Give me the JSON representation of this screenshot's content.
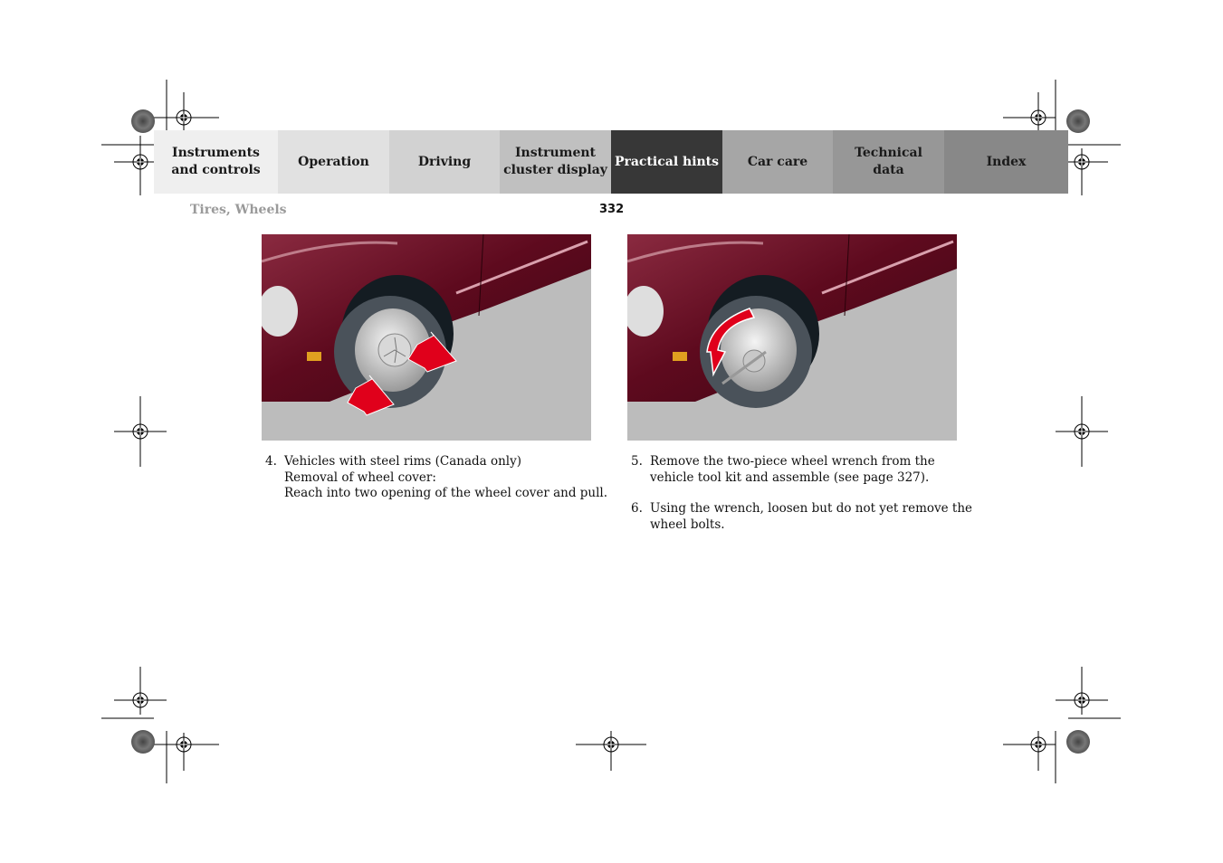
{
  "nav": {
    "tabs": [
      {
        "label": "Instruments\nand controls",
        "active": false
      },
      {
        "label": "Operation",
        "active": false
      },
      {
        "label": "Driving",
        "active": false
      },
      {
        "label": "Instrument\ncluster display",
        "active": false
      },
      {
        "label": "Practical hints",
        "active": true
      },
      {
        "label": "Car care",
        "active": false
      },
      {
        "label": "Technical\ndata",
        "active": false
      },
      {
        "label": "Index",
        "active": false
      }
    ]
  },
  "header": {
    "section": "Tires, Wheels",
    "page_number": "332"
  },
  "figures": [
    {
      "name": "wheel-cover-removal-illustration",
      "arrows": "two straight red arrows pulling wheel cover outward"
    },
    {
      "name": "wheel-wrench-loosening-illustration",
      "arrows": "curved red arrow counter-clockwise"
    }
  ],
  "steps": [
    {
      "number": "4.",
      "text": "Vehicles with steel rims (Canada only)\nRemoval of wheel cover:\nReach into two opening of the wheel cover and pull."
    },
    {
      "number": "5.",
      "text": "Remove the two-piece wheel wrench from the\nvehicle tool kit and assemble (see page 327)."
    },
    {
      "number": "6.",
      "text": "Using the wrench, loosen but do not yet remove the\nwheel bolts."
    }
  ],
  "colors": {
    "active_tab": "#373737",
    "car_body": "#5e0a1e",
    "arrow": "#e0001b",
    "ground": "#bcbcbc"
  }
}
